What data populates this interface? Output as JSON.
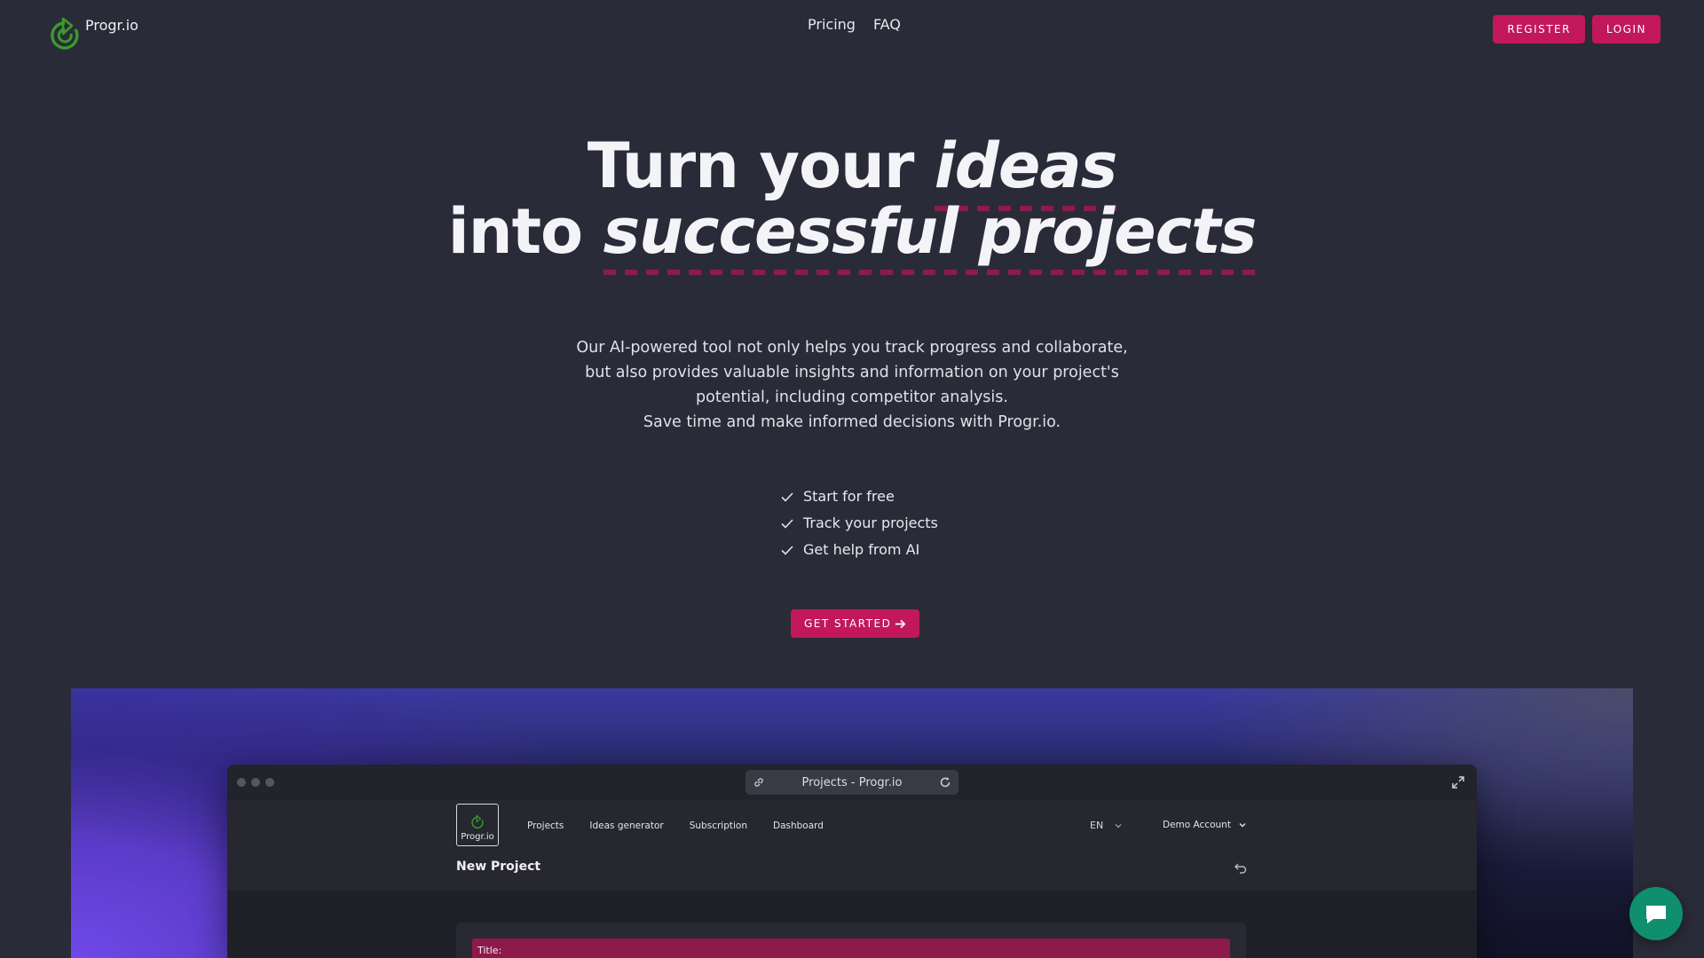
{
  "header": {
    "brand": "Progr.io",
    "nav": [
      "Pricing",
      "FAQ"
    ],
    "register_label": "REGISTER",
    "login_label": "LOGIN"
  },
  "hero": {
    "line1_plain": "Turn your ",
    "line1_italic": "ideas",
    "line2_plain": "into ",
    "line2_italic": "successful projects",
    "description": [
      "Our AI-powered tool not only helps you track progress and collaborate,",
      "but also provides valuable insights and information on your project's",
      "potential, including competitor analysis.",
      "Save time and make informed decisions with Progr.io."
    ],
    "checks": [
      "Start for free",
      "Track your projects",
      "Get help from AI"
    ],
    "cta_label": "GET STARTED"
  },
  "preview": {
    "url_title": "Projects - Progr.io",
    "app_brand": "Progr.io",
    "app_nav": [
      "Projects",
      "Ideas generator",
      "Subscription",
      "Dashboard"
    ],
    "language": "EN",
    "account": "Demo Account",
    "page_title": "New Project",
    "title_field_label": "Title:"
  },
  "colors": {
    "background": "#2a2b38",
    "accent": "#c2185b",
    "logo_green": "#3c9a2c",
    "chat": "#0f8f6e"
  },
  "icons": [
    "logo-icon",
    "check-icon",
    "arrow-right-icon",
    "link-icon",
    "reload-icon",
    "expand-icon",
    "chevron-down-icon",
    "undo-icon",
    "chat-icon"
  ]
}
